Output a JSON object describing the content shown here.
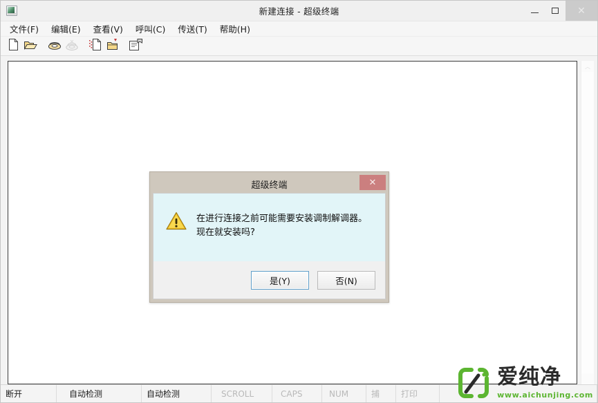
{
  "window": {
    "title": "新建连接 - 超级终端",
    "icon": "terminal-window-icon",
    "controls": {
      "minimize": "—",
      "maximize": "❐",
      "close": "✕"
    }
  },
  "menu": {
    "items": [
      {
        "label": "文件(F)"
      },
      {
        "label": "编辑(E)"
      },
      {
        "label": "查看(V)"
      },
      {
        "label": "呼叫(C)"
      },
      {
        "label": "传送(T)"
      },
      {
        "label": "帮助(H)"
      }
    ]
  },
  "toolbar": {
    "buttons": [
      {
        "name": "new-connection-icon",
        "title": "新建连接"
      },
      {
        "name": "open-folder-icon",
        "title": "打开"
      },
      {
        "name": "call-phone-icon",
        "title": "呼叫"
      },
      {
        "name": "hangup-phone-icon",
        "title": "挂断",
        "disabled": true
      },
      {
        "name": "send-file-icon",
        "title": "发送文件"
      },
      {
        "name": "receive-file-icon",
        "title": "接收文件"
      },
      {
        "name": "properties-icon",
        "title": "属性"
      }
    ]
  },
  "terminal": {
    "content": ""
  },
  "scrollbar": {
    "up_arrow": "︿",
    "down_arrow": "﹀"
  },
  "status_bar": {
    "cells": [
      {
        "label": "断开",
        "dim": false
      },
      {
        "label": "自动检测",
        "dim": false
      },
      {
        "label": "自动检测",
        "dim": false
      },
      {
        "label": "SCROLL",
        "dim": true
      },
      {
        "label": "CAPS",
        "dim": true
      },
      {
        "label": "NUM",
        "dim": true
      },
      {
        "label": "捕",
        "dim": true
      },
      {
        "label": "打印",
        "dim": true
      }
    ]
  },
  "dialog": {
    "title": "超级终端",
    "close_glyph": "✕",
    "icon": "warning-triangle-icon",
    "message": "在进行连接之前可能需要安装调制解调器。\n现在就安装吗?",
    "buttons": {
      "yes": "是(Y)",
      "no": "否(N)"
    }
  },
  "watermark": {
    "name": "爱纯净",
    "url": "www.aichunjing.com",
    "accent_color": "#5cb531"
  },
  "colors": {
    "window_chrome": "#f0f0f0",
    "dialog_frame": "#cfc8bd",
    "dialog_body": "#e2f5f8",
    "close_button": "#cb7f7f",
    "default_button_border": "#5f9ec9",
    "status_dim_text": "#b9b9b9"
  }
}
